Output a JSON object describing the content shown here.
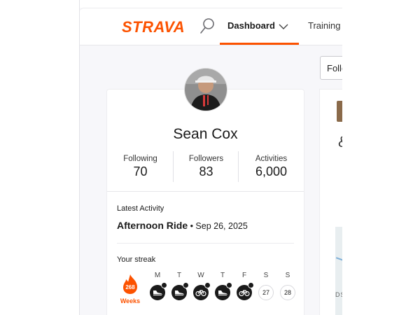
{
  "nav": {
    "logo": "STRAVA",
    "dashboard_label": "Dashboard",
    "training_label": "Training",
    "accent": "#fc5200"
  },
  "profile": {
    "name": "Sean Cox",
    "stats": [
      {
        "label": "Following",
        "value": "70"
      },
      {
        "label": "Followers",
        "value": "83"
      },
      {
        "label": "Activities",
        "value": "6,000"
      }
    ]
  },
  "latest_activity": {
    "label": "Latest Activity",
    "title": "Afternoon Ride",
    "date": " • Sep 26, 2025"
  },
  "streak": {
    "label": "Your streak",
    "weeks_count": "268",
    "weeks_label": "Weeks",
    "days": [
      {
        "letter": "M",
        "icon": "shoe-icon"
      },
      {
        "letter": "T",
        "icon": "shoe-icon"
      },
      {
        "letter": "W",
        "icon": "bike-icon"
      },
      {
        "letter": "T",
        "icon": "shoe-icon"
      },
      {
        "letter": "F",
        "icon": "bike-icon"
      },
      {
        "letter": "S",
        "number": "27"
      },
      {
        "letter": "S",
        "number": "28"
      }
    ]
  },
  "feed": {
    "filter_partial": "Follo",
    "glyph": "&",
    "map_text": "DS"
  }
}
